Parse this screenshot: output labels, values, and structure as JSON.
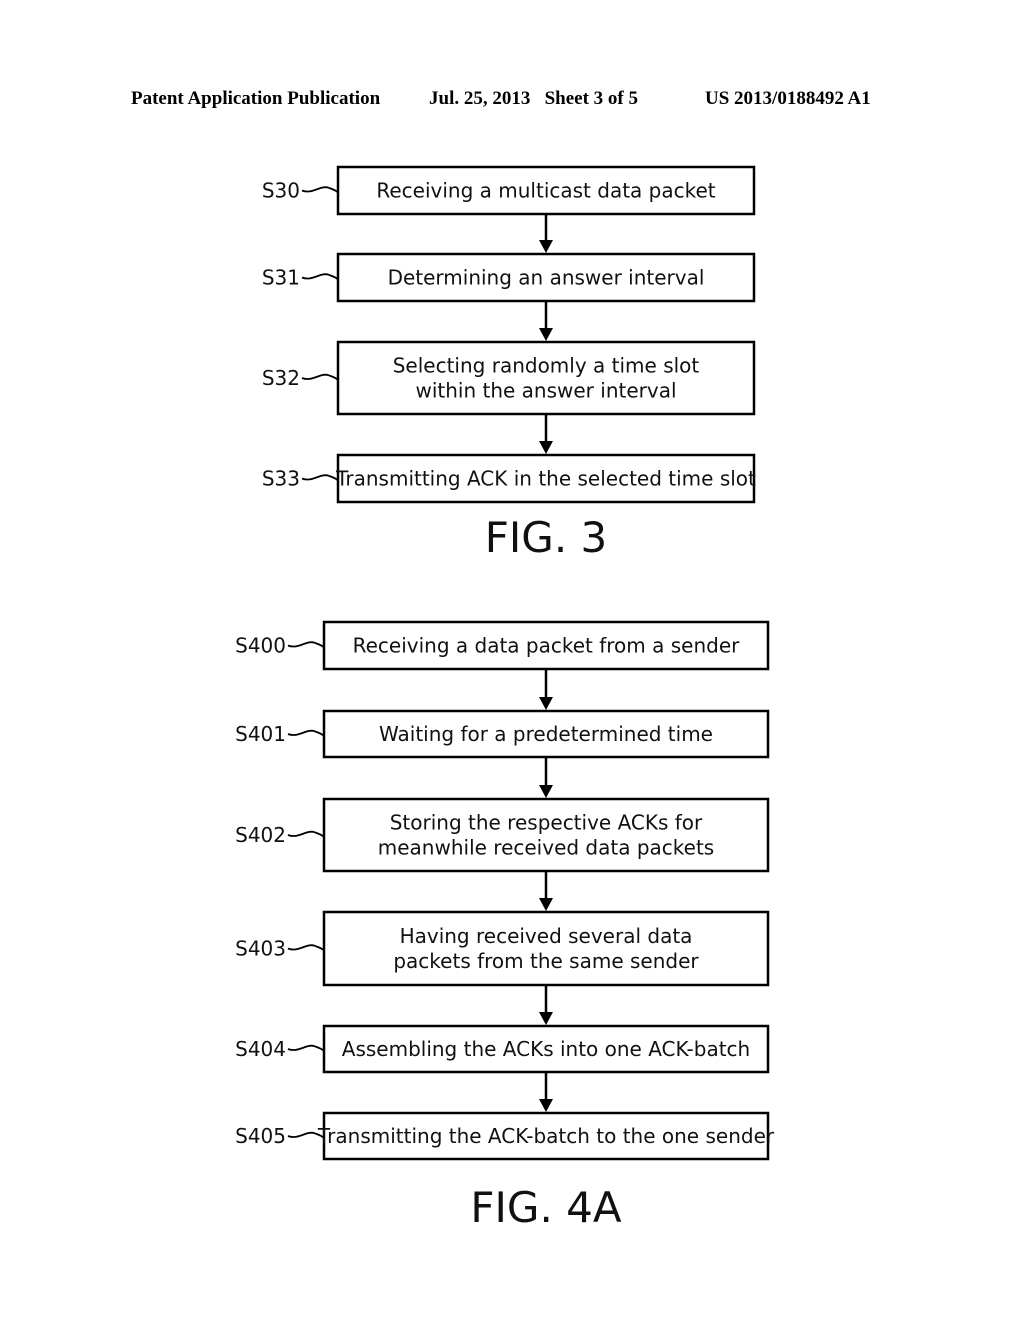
{
  "header": {
    "left": "Patent Application Publication",
    "middle": "Jul. 25, 2013   Sheet 3 of 5",
    "right": "US 2013/0188492 A1"
  },
  "figures": [
    {
      "caption": "FIG. 3",
      "steps": [
        {
          "id": "S30",
          "lines": [
            "Receiving a multicast data packet"
          ]
        },
        {
          "id": "S31",
          "lines": [
            "Determining an answer interval"
          ]
        },
        {
          "id": "S32",
          "lines": [
            "Selecting randomly a time slot",
            "within the answer interval"
          ]
        },
        {
          "id": "S33",
          "lines": [
            "Transmitting ACK in the selected time slot"
          ]
        }
      ]
    },
    {
      "caption": "FIG. 4A",
      "steps": [
        {
          "id": "S400",
          "lines": [
            "Receiving a data packet from a sender"
          ]
        },
        {
          "id": "S401",
          "lines": [
            "Waiting for a predetermined time"
          ]
        },
        {
          "id": "S402",
          "lines": [
            "Storing the respective ACKs for",
            "meanwhile received data packets"
          ]
        },
        {
          "id": "S403",
          "lines": [
            "Having received several data",
            "packets from the same sender"
          ]
        },
        {
          "id": "S404",
          "lines": [
            "Assembling the ACKs into one ACK-batch"
          ]
        },
        {
          "id": "S405",
          "lines": [
            "Transmitting the ACK-batch to the one sender"
          ]
        }
      ]
    }
  ]
}
